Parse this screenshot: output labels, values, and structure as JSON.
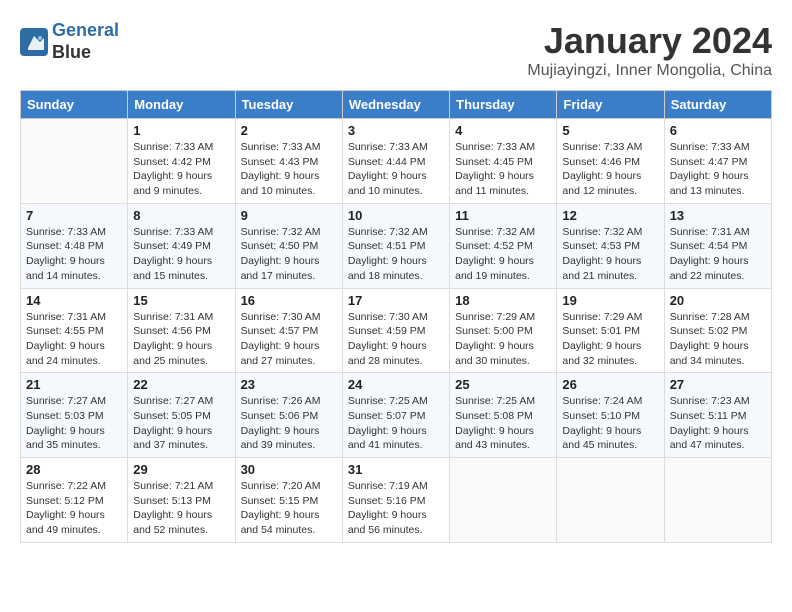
{
  "header": {
    "logo_line1": "General",
    "logo_line2": "Blue",
    "title": "January 2024",
    "subtitle": "Mujiayingzi, Inner Mongolia, China"
  },
  "calendar": {
    "days_of_week": [
      "Sunday",
      "Monday",
      "Tuesday",
      "Wednesday",
      "Thursday",
      "Friday",
      "Saturday"
    ],
    "weeks": [
      [
        {
          "day": "",
          "info": ""
        },
        {
          "day": "1",
          "info": "Sunrise: 7:33 AM\nSunset: 4:42 PM\nDaylight: 9 hours\nand 9 minutes."
        },
        {
          "day": "2",
          "info": "Sunrise: 7:33 AM\nSunset: 4:43 PM\nDaylight: 9 hours\nand 10 minutes."
        },
        {
          "day": "3",
          "info": "Sunrise: 7:33 AM\nSunset: 4:44 PM\nDaylight: 9 hours\nand 10 minutes."
        },
        {
          "day": "4",
          "info": "Sunrise: 7:33 AM\nSunset: 4:45 PM\nDaylight: 9 hours\nand 11 minutes."
        },
        {
          "day": "5",
          "info": "Sunrise: 7:33 AM\nSunset: 4:46 PM\nDaylight: 9 hours\nand 12 minutes."
        },
        {
          "day": "6",
          "info": "Sunrise: 7:33 AM\nSunset: 4:47 PM\nDaylight: 9 hours\nand 13 minutes."
        }
      ],
      [
        {
          "day": "7",
          "info": "Sunrise: 7:33 AM\nSunset: 4:48 PM\nDaylight: 9 hours\nand 14 minutes."
        },
        {
          "day": "8",
          "info": "Sunrise: 7:33 AM\nSunset: 4:49 PM\nDaylight: 9 hours\nand 15 minutes."
        },
        {
          "day": "9",
          "info": "Sunrise: 7:32 AM\nSunset: 4:50 PM\nDaylight: 9 hours\nand 17 minutes."
        },
        {
          "day": "10",
          "info": "Sunrise: 7:32 AM\nSunset: 4:51 PM\nDaylight: 9 hours\nand 18 minutes."
        },
        {
          "day": "11",
          "info": "Sunrise: 7:32 AM\nSunset: 4:52 PM\nDaylight: 9 hours\nand 19 minutes."
        },
        {
          "day": "12",
          "info": "Sunrise: 7:32 AM\nSunset: 4:53 PM\nDaylight: 9 hours\nand 21 minutes."
        },
        {
          "day": "13",
          "info": "Sunrise: 7:31 AM\nSunset: 4:54 PM\nDaylight: 9 hours\nand 22 minutes."
        }
      ],
      [
        {
          "day": "14",
          "info": "Sunrise: 7:31 AM\nSunset: 4:55 PM\nDaylight: 9 hours\nand 24 minutes."
        },
        {
          "day": "15",
          "info": "Sunrise: 7:31 AM\nSunset: 4:56 PM\nDaylight: 9 hours\nand 25 minutes."
        },
        {
          "day": "16",
          "info": "Sunrise: 7:30 AM\nSunset: 4:57 PM\nDaylight: 9 hours\nand 27 minutes."
        },
        {
          "day": "17",
          "info": "Sunrise: 7:30 AM\nSunset: 4:59 PM\nDaylight: 9 hours\nand 28 minutes."
        },
        {
          "day": "18",
          "info": "Sunrise: 7:29 AM\nSunset: 5:00 PM\nDaylight: 9 hours\nand 30 minutes."
        },
        {
          "day": "19",
          "info": "Sunrise: 7:29 AM\nSunset: 5:01 PM\nDaylight: 9 hours\nand 32 minutes."
        },
        {
          "day": "20",
          "info": "Sunrise: 7:28 AM\nSunset: 5:02 PM\nDaylight: 9 hours\nand 34 minutes."
        }
      ],
      [
        {
          "day": "21",
          "info": "Sunrise: 7:27 AM\nSunset: 5:03 PM\nDaylight: 9 hours\nand 35 minutes."
        },
        {
          "day": "22",
          "info": "Sunrise: 7:27 AM\nSunset: 5:05 PM\nDaylight: 9 hours\nand 37 minutes."
        },
        {
          "day": "23",
          "info": "Sunrise: 7:26 AM\nSunset: 5:06 PM\nDaylight: 9 hours\nand 39 minutes."
        },
        {
          "day": "24",
          "info": "Sunrise: 7:25 AM\nSunset: 5:07 PM\nDaylight: 9 hours\nand 41 minutes."
        },
        {
          "day": "25",
          "info": "Sunrise: 7:25 AM\nSunset: 5:08 PM\nDaylight: 9 hours\nand 43 minutes."
        },
        {
          "day": "26",
          "info": "Sunrise: 7:24 AM\nSunset: 5:10 PM\nDaylight: 9 hours\nand 45 minutes."
        },
        {
          "day": "27",
          "info": "Sunrise: 7:23 AM\nSunset: 5:11 PM\nDaylight: 9 hours\nand 47 minutes."
        }
      ],
      [
        {
          "day": "28",
          "info": "Sunrise: 7:22 AM\nSunset: 5:12 PM\nDaylight: 9 hours\nand 49 minutes."
        },
        {
          "day": "29",
          "info": "Sunrise: 7:21 AM\nSunset: 5:13 PM\nDaylight: 9 hours\nand 52 minutes."
        },
        {
          "day": "30",
          "info": "Sunrise: 7:20 AM\nSunset: 5:15 PM\nDaylight: 9 hours\nand 54 minutes."
        },
        {
          "day": "31",
          "info": "Sunrise: 7:19 AM\nSunset: 5:16 PM\nDaylight: 9 hours\nand 56 minutes."
        },
        {
          "day": "",
          "info": ""
        },
        {
          "day": "",
          "info": ""
        },
        {
          "day": "",
          "info": ""
        }
      ]
    ]
  }
}
